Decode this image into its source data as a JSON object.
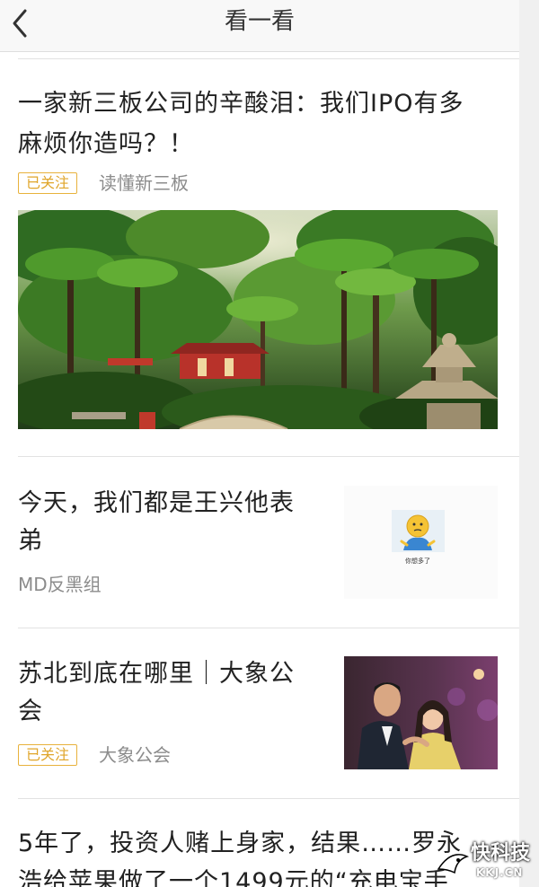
{
  "nav": {
    "title": "看一看",
    "back_icon": "chevron-left-icon"
  },
  "articles": [
    {
      "title_line1": "一家新三板公司的辛酸泪：我们IPO有多",
      "title_line2": "麻烦你造吗？！",
      "badge": "已关注",
      "source": "读懂新三板",
      "image": "tropical-garden-photo"
    },
    {
      "title_line1": "今天，我们都是王兴他表",
      "title_line2": "弟",
      "source": "MD反黑组",
      "thumb_caption": "你想多了",
      "image": "confused-emoji-thumbnail"
    },
    {
      "title_line1": "苏北到底在哪里｜大象公",
      "title_line2": "会",
      "badge": "已关注",
      "source": "大象公会",
      "image": "couple-photo-thumbnail"
    },
    {
      "title_line1": "5年了，投资人赌上身家，结果……罗永",
      "title_line2": "浩给苹果做了一个1499元的“充电宝手"
    }
  ],
  "watermark": {
    "text": "快科技",
    "sub": "KKJ.CN"
  },
  "colors": {
    "badge": "#e0a52a",
    "source": "#8c8c8c",
    "nav_bg": "#f8f8f8",
    "divider": "#e2e2e2"
  }
}
